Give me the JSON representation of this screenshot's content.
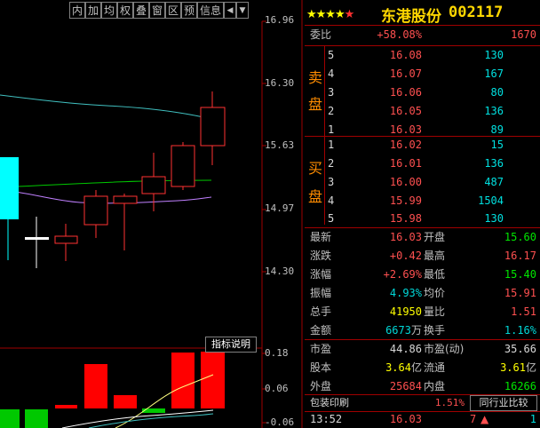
{
  "toolbar": {
    "buttons": [
      "内",
      "加",
      "均",
      "权",
      "叠",
      "窗",
      "区",
      "预",
      "信息",
      "◀",
      "▼"
    ]
  },
  "price_axis": [
    "16.96",
    "16.30",
    "15.63",
    "14.97",
    "14.30"
  ],
  "indicator": {
    "button_label": "指标说明",
    "axis": [
      "0.18",
      "0.06",
      "-0.06"
    ]
  },
  "stock": {
    "name": "东港股份",
    "code": "002117",
    "stars": 5
  },
  "weibi": {
    "label": "委比",
    "percent": "+58.08%",
    "diff": "1670"
  },
  "orderbook": {
    "sell_label": [
      "卖",
      "盘"
    ],
    "buy_label": [
      "买",
      "盘"
    ],
    "sell": [
      {
        "level": "5",
        "price": "16.08",
        "volume": "130"
      },
      {
        "level": "4",
        "price": "16.07",
        "volume": "167"
      },
      {
        "level": "3",
        "price": "16.06",
        "volume": "80"
      },
      {
        "level": "2",
        "price": "16.05",
        "volume": "136"
      },
      {
        "level": "1",
        "price": "16.03",
        "volume": "89"
      }
    ],
    "buy": [
      {
        "level": "1",
        "price": "16.02",
        "volume": "15"
      },
      {
        "level": "2",
        "price": "16.01",
        "volume": "136"
      },
      {
        "level": "3",
        "price": "16.00",
        "volume": "487"
      },
      {
        "level": "4",
        "price": "15.99",
        "volume": "1504"
      },
      {
        "level": "5",
        "price": "15.98",
        "volume": "130"
      }
    ]
  },
  "quote": {
    "latest_label": "最新",
    "latest": "16.03",
    "open_label": "开盘",
    "open": "15.60",
    "change_label": "涨跌",
    "change": "+0.42",
    "high_label": "最高",
    "high": "16.17",
    "pct_label": "涨幅",
    "pct": "+2.69%",
    "low_label": "最低",
    "low": "15.40",
    "amp_label": "振幅",
    "amp": "4.93%",
    "avg_label": "均价",
    "avg": "15.91",
    "total_label": "总手",
    "total": "41950",
    "ratio_label": "量比",
    "ratio": "1.51",
    "amount_label": "金额",
    "amount_num": "6673",
    "amount_unit": "万",
    "turnover_label": "换手",
    "turnover": "1.16%",
    "pe_label": "市盈",
    "pe": "44.86",
    "pe_dyn_label": "市盈(动)",
    "pe_dyn": "35.66",
    "share_label": "股本",
    "share_num": "3.64",
    "share_unit": "亿",
    "float_label": "流通",
    "float_num": "3.61",
    "float_unit": "亿",
    "outer_label": "外盘",
    "outer": "25684",
    "inner_label": "内盘",
    "inner": "16266"
  },
  "industry": {
    "name": "包装印刷",
    "pct": "1.51%",
    "compare_label": "同行业比较"
  },
  "tick": {
    "time": "13:52",
    "price": "16.03",
    "volume": "7",
    "count": "1"
  },
  "colors": {
    "up": "#ff3232",
    "down": "#00ffff",
    "border": "#a00000",
    "ma_white": "#ffffff",
    "ma_cyan": "#40c0c0",
    "ma_green": "#00c800",
    "ma_purple": "#c080ff"
  }
}
